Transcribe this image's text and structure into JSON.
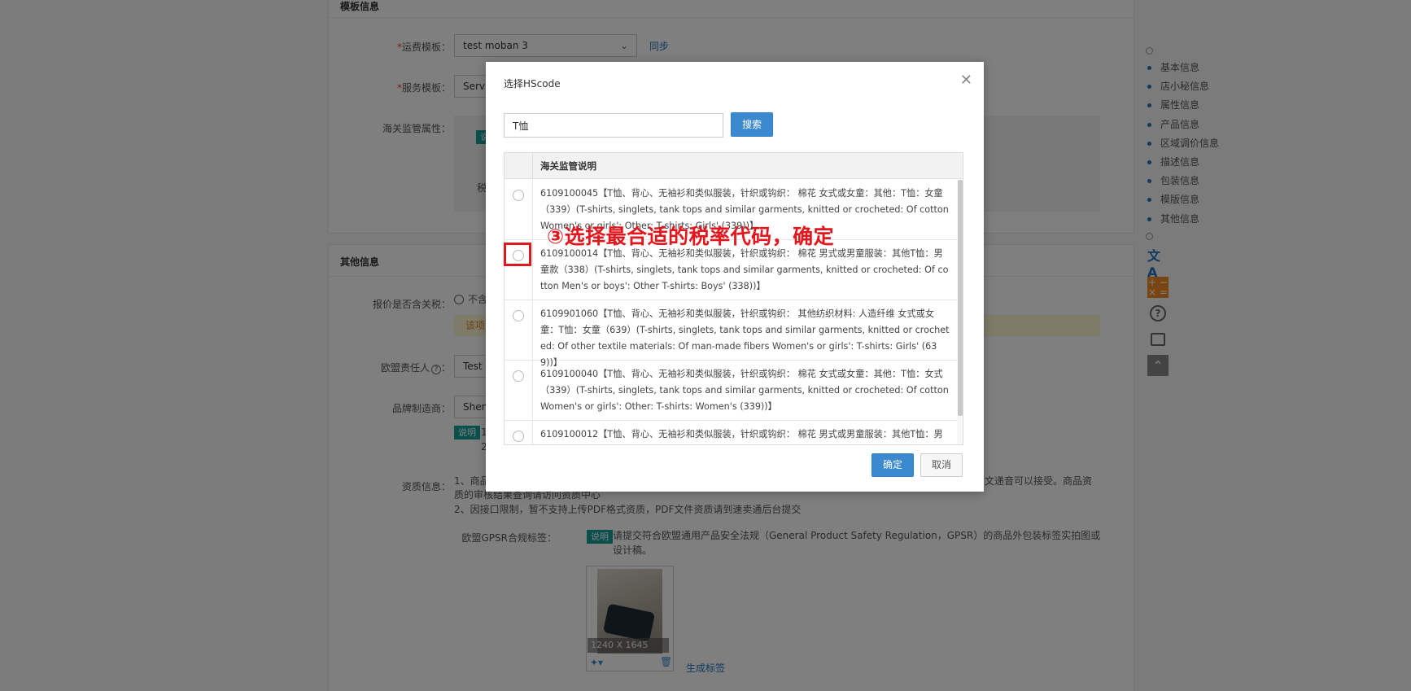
{
  "background": {
    "template_section_title": "模板信息",
    "freight_label": "运费模板：",
    "freight_value": "test moban 3",
    "sync_link": "同步",
    "service_label": "服务模板：",
    "service_value": "Servic",
    "customs_label": "海关监管属性：",
    "customs_tag": "说",
    "customs_tax_label": "税",
    "other_section_title": "其他信息",
    "tax_included_label": "报价是否含关税：",
    "tax_included_option": "不含",
    "warning_text": "该项",
    "eu_rep_label": "欧盟责任人",
    "eu_rep_value": "Test",
    "brand_label": "品牌制造商：",
    "brand_value": "Shen",
    "brand_tag": "说明",
    "brand_note_1": "1",
    "brand_note_2": "2",
    "qual_label": "资质信息：",
    "qual_line1_start": "1、商品",
    "qual_line1_end": "文递音可以接受。商品资",
    "qual_line2": "质的审核结果查询请访问资质中心",
    "qual_line3": "2、因接口限制，暂不支持上传PDF格式资质，PDF文件资质请到速卖通后台提交",
    "gpsr_label": "欧盟GPSR合规标签：",
    "gpsr_tag": "说明",
    "gpsr_text": "请提交符合欧盟通用产品安全法规（General Product Safety Regulation，GPSR）的商品外包装标签实拍图或设计稿。",
    "image_size": "1240 X 1645",
    "generate_label_link": "生成标签"
  },
  "side_nav": {
    "items": [
      "基本信息",
      "店小秘信息",
      "属性信息",
      "产品信息",
      "区域调价信息",
      "描述信息",
      "包装信息",
      "模版信息",
      "其他信息"
    ],
    "tools": [
      "translate-icon",
      "calculator-icon",
      "help-icon",
      "box-icon",
      "back-to-top-icon"
    ]
  },
  "modal": {
    "title": "选择HScode",
    "search_value": "T恤",
    "search_button": "搜索",
    "column_header": "海关监管说明",
    "rows": [
      "6109100045【T恤、背心、无袖衫和类似服装，针织或钩织： 棉花 女式或女童：其他：T恤：女童（339）(T-shirts, singlets, tank tops and similar garments, knitted or crocheted: Of cotton Women's or girls': Other: T-shirts: Girls' (339))】",
      "6109100014【T恤、背心、无袖衫和类似服装，针织或钩织： 棉花 男式或男童服装：其他T恤：男童款（338）(T-shirts, singlets, tank tops and similar garments, knitted or crocheted: Of cotton Men's or boys': Other T-shirts: Boys' (338))】",
      "6109901060【T恤、背心、无袖衫和类似服装，针织或钩织： 其他纺织材料: 人造纤维 女式或女童：T恤：女童（639）(T-shirts, singlets, tank tops and similar garments, knitted or crocheted: Of other textile materials: Of man-made fibers Women's or girls': T-shirts: Girls' (639))】",
      "6109100040【T恤、背心、无袖衫和类似服装，针织或钩织： 棉花 女式或女童：其他：T恤：女式（339）(T-shirts, singlets, tank tops and similar garments, knitted or crocheted: Of cotton Women's or girls': Other: T-shirts: Women's (339))】",
      "6109100012【T恤、背心、无袖衫和类似服装，针织或钩织： 棉花 男式或男童服装：其他T恤：男"
    ],
    "confirm_button": "确定",
    "cancel_button": "取消"
  },
  "annotation": "③选择最合适的税率代码，确定",
  "colors": {
    "accent": "#3b8ad0",
    "annotation": "#e3161d",
    "tag": "#12a19b"
  }
}
